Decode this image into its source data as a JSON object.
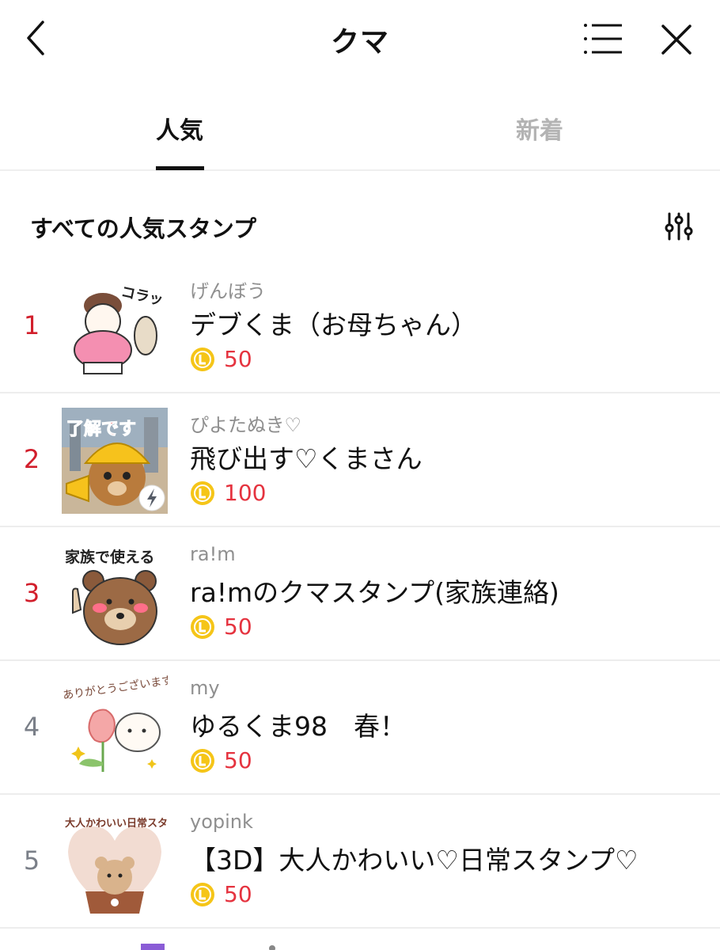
{
  "header": {
    "title": "クマ",
    "back_icon": "chevron-left-icon",
    "list_icon": "list-icon",
    "close_icon": "close-icon"
  },
  "tabs": [
    {
      "label": "人気",
      "active": true
    },
    {
      "label": "新着",
      "active": false
    }
  ],
  "section": {
    "title": "すべての人気スタンプ",
    "filter_icon": "sliders-icon"
  },
  "colors": {
    "rank_top": "#d21f2c",
    "rank_normal": "#7a7f88",
    "price": "#e5333f",
    "coin": "#f5c518"
  },
  "stickers": [
    {
      "rank": "1",
      "author": "げんぼう",
      "name": "デブくま（お母ちゃん）",
      "price": "50",
      "thumb_text": "コラッ"
    },
    {
      "rank": "2",
      "author": "ぴよたぬき♡",
      "name": "飛び出す♡くまさん",
      "price": "100",
      "thumb_text": "了解です",
      "badge_icon": "lightning-icon"
    },
    {
      "rank": "3",
      "author": "ra!m",
      "name": "ra!mのクマスタンプ(家族連絡)",
      "price": "50",
      "thumb_text": "家族で使える"
    },
    {
      "rank": "4",
      "author": "my",
      "name": "ゆるくま98　春！",
      "price": "50",
      "thumb_text": "ありがとうございます"
    },
    {
      "rank": "5",
      "author": "yopink",
      "name": "【3D】大人かわいい♡日常スタンプ♡",
      "price": "50",
      "thumb_text": "大人かわいい日常スタンプ"
    }
  ]
}
